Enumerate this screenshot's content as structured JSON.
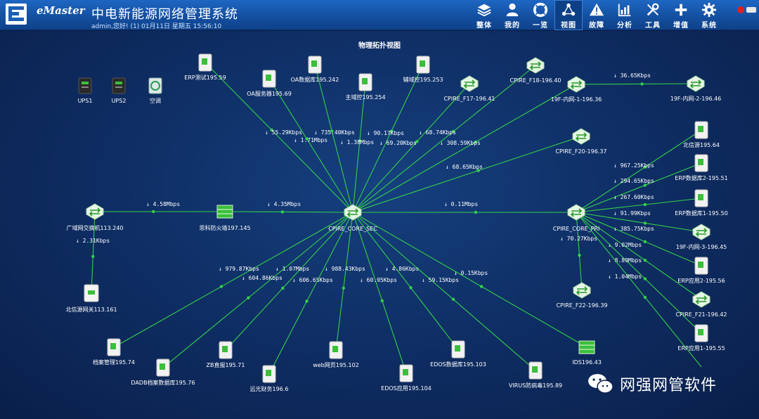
{
  "header": {
    "brand": "eMaster",
    "title": "中电新能源网络管理系统",
    "user_info": "admin,您好! (1) 01月11日 星期五 15:56:10"
  },
  "nav": [
    {
      "key": "overall",
      "label": "整体",
      "icon": "layers-icon"
    },
    {
      "key": "mine",
      "label": "我的",
      "icon": "user-icon"
    },
    {
      "key": "overview",
      "label": "一览",
      "icon": "lifebuoy-icon"
    },
    {
      "key": "view",
      "label": "视图",
      "icon": "topology-icon",
      "active": true
    },
    {
      "key": "fault",
      "label": "故障",
      "icon": "warning-icon"
    },
    {
      "key": "analysis",
      "label": "分析",
      "icon": "chart-icon"
    },
    {
      "key": "tools",
      "label": "工具",
      "icon": "tools-icon"
    },
    {
      "key": "addon",
      "label": "增值",
      "icon": "plus-icon"
    },
    {
      "key": "system",
      "label": "系统",
      "icon": "gear-icon"
    }
  ],
  "topology": {
    "title": "物理拓扑视图",
    "nodes": [
      {
        "id": "sec",
        "label": "CPIRE_CORE_SEC",
        "type": "switch"
      },
      {
        "id": "pri",
        "label": "CPIRE_CORE_PRI",
        "type": "switch"
      },
      {
        "id": "ups1",
        "label": "UPS1",
        "type": "ups"
      },
      {
        "id": "ups2",
        "label": "UPS2",
        "type": "ups"
      },
      {
        "id": "ac",
        "label": "空调",
        "type": "ac"
      },
      {
        "id": "erptest",
        "label": "ERP测试195.59",
        "type": "server"
      },
      {
        "id": "oasrv",
        "label": "OA服务器195.69",
        "type": "server"
      },
      {
        "id": "oadb",
        "label": "OA数据库195.242",
        "type": "server"
      },
      {
        "id": "main",
        "label": "主域控195.254",
        "type": "server"
      },
      {
        "id": "aux",
        "label": "辅域控195.253",
        "type": "server"
      },
      {
        "id": "f17",
        "label": "CPIRE_F17-196.41",
        "type": "switch"
      },
      {
        "id": "f18",
        "label": "CPIRE_F18-196.40",
        "type": "switch"
      },
      {
        "id": "in1",
        "label": "19F-内网-1-196.36",
        "type": "switch"
      },
      {
        "id": "in2",
        "label": "19F-内网-2-196.46",
        "type": "switch"
      },
      {
        "id": "f20",
        "label": "CPIRE_F20-196.37",
        "type": "switch"
      },
      {
        "id": "bxy",
        "label": "北信源195.64",
        "type": "server"
      },
      {
        "id": "erpdb2",
        "label": "ERP数据库2-195.51",
        "type": "server"
      },
      {
        "id": "erpdb1",
        "label": "ERP数据库1-195.50",
        "type": "server"
      },
      {
        "id": "in3",
        "label": "19F-内网-3-196.45",
        "type": "switch"
      },
      {
        "id": "erpapp2",
        "label": "ERP应用2-195.56",
        "type": "server"
      },
      {
        "id": "f21",
        "label": "CPIRE_F21-196.42",
        "type": "switch"
      },
      {
        "id": "erpapp1",
        "label": "ERP应用1-195.55",
        "type": "server"
      },
      {
        "id": "f22",
        "label": "CPIRE_F22-196.39",
        "type": "switch"
      },
      {
        "id": "wan",
        "label": "广域网交换机113.240",
        "type": "switch"
      },
      {
        "id": "fw",
        "label": "思科防火墙197.145",
        "type": "firewall"
      },
      {
        "id": "bxygw",
        "label": "北信源网关113.161",
        "type": "gateway"
      },
      {
        "id": "archive",
        "label": "档案管理195.74",
        "type": "server"
      },
      {
        "id": "dadb",
        "label": "DADB档案数据库195.76",
        "type": "server"
      },
      {
        "id": "zb",
        "label": "ZB直报195.71",
        "type": "server"
      },
      {
        "id": "yuanguang",
        "label": "远光财务196.6",
        "type": "server"
      },
      {
        "id": "web",
        "label": "web网页195.102",
        "type": "server"
      },
      {
        "id": "edosapp",
        "label": "EDOS应用195.104",
        "type": "server"
      },
      {
        "id": "edosdb",
        "label": "EDOS数据库195.103",
        "type": "server"
      },
      {
        "id": "virus",
        "label": "VIRUS防病毒195.89",
        "type": "server"
      },
      {
        "id": "ids",
        "label": "IDS196.43",
        "type": "firewall"
      }
    ],
    "links": [
      {
        "from": "sec",
        "to": "erptest",
        "rate": "↓ 55.29Kbps"
      },
      {
        "from": "sec",
        "to": "oasrv",
        "rate": "↓ 1.71Mbps"
      },
      {
        "from": "sec",
        "to": "oadb",
        "rate": "↓ 735.40Kbps"
      },
      {
        "from": "sec",
        "to": "main",
        "rate": "↓ 1.38Mbps"
      },
      {
        "from": "sec",
        "to": "aux",
        "rate": "↓ 90.17Kbps"
      },
      {
        "from": "sec",
        "to": "f17",
        "rate": "↓ 69.20Kbps"
      },
      {
        "from": "sec",
        "to": "f18",
        "rate": "↓ 68.74Kbps"
      },
      {
        "from": "sec",
        "to": "in1",
        "rate": "↓ 308.59Kbps"
      },
      {
        "from": "sec",
        "to": "f20",
        "rate": "↓ 68.65Kbps"
      },
      {
        "from": "sec",
        "to": "pri",
        "rate": "↓ 0.11Mbps"
      },
      {
        "from": "sec",
        "to": "fw",
        "rate": "↓ 4.35Mbps"
      },
      {
        "from": "fw",
        "to": "wan",
        "rate": "↓ 4.58Mbps"
      },
      {
        "from": "wan",
        "to": "bxygw",
        "rate": "↓ 2.31Kbps"
      },
      {
        "from": "in1",
        "to": "in2",
        "rate": "↓ 36.65Kbps"
      },
      {
        "from": "sec",
        "to": "archive",
        "rate": "↓ 979.87Kbps"
      },
      {
        "from": "sec",
        "to": "dadb",
        "rate": "↓ 604.86Kbps"
      },
      {
        "from": "sec",
        "to": "zb",
        "rate": "↓ 606.65Kbps"
      },
      {
        "from": "sec",
        "to": "yuanguang",
        "rate": "↓ 1.07Mbps"
      },
      {
        "from": "sec",
        "to": "web",
        "rate": "↓ 988.43Kbps"
      },
      {
        "from": "sec",
        "to": "edosapp",
        "rate": "↓ 60.95Kbps"
      },
      {
        "from": "sec",
        "to": "edosdb",
        "rate": "↓ 4.86Kbps"
      },
      {
        "from": "sec",
        "to": "virus",
        "rate": "↓ 59.15Kbps"
      },
      {
        "from": "sec",
        "to": "ids",
        "rate": "↓ 0.15Kbps"
      },
      {
        "from": "pri",
        "to": "bxy",
        "rate": "↓ 967.25Kbps"
      },
      {
        "from": "pri",
        "to": "erpdb2",
        "rate": "↓ 294.65Kbps"
      },
      {
        "from": "pri",
        "to": "erpdb1",
        "rate": "↓ 267.60Kbps"
      },
      {
        "from": "pri",
        "to": "in3",
        "rate": "↓ 91.99Kbps"
      },
      {
        "from": "pri",
        "to": "erpapp2",
        "rate": "↓ 385.75Kbps"
      },
      {
        "from": "pri",
        "to": "f21",
        "rate": "↓ 9.02Mbps"
      },
      {
        "from": "pri",
        "to": "erpapp1",
        "rate": "↓ 8.89Mbps"
      },
      {
        "from": "pri",
        "to": "f21b",
        "rate": "↓ 1.04Mbps"
      },
      {
        "from": "pri",
        "to": "f22",
        "rate": "↓ 70.27Kbps"
      }
    ]
  },
  "watermark": {
    "text": "网强网管软件",
    "icon": "wechat-icon"
  }
}
